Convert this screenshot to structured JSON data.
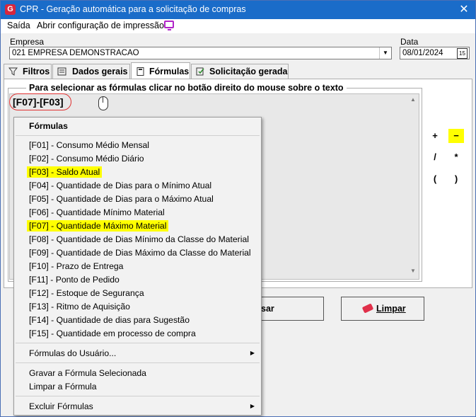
{
  "window": {
    "title": "CPR - Geração automática para a solicitação de compras",
    "close_glyph": "✕",
    "icon": "cpr-app-icon"
  },
  "menubar": {
    "items": [
      "Saída",
      "Abrir configuração de impressão"
    ],
    "print_icon": "monitor-print-icon"
  },
  "form": {
    "empresa_label": "Empresa",
    "empresa_value": "021 EMPRESA DEMONSTRACAO",
    "data_label": "Data",
    "data_value": "08/01/2024",
    "calendar_glyph": "15"
  },
  "tabs": [
    {
      "label": "Filtros",
      "icon": "filter-icon",
      "active": false
    },
    {
      "label": "Dados gerais",
      "icon": "data-icon",
      "active": false
    },
    {
      "label": "Fórmulas",
      "icon": "calculator-icon",
      "active": true
    },
    {
      "label": "Solicitação gerada",
      "icon": "document-check-icon",
      "active": false
    }
  ],
  "formulas_tab": {
    "group_title": "Para selecionar as fórmulas clicar no botão direito do mouse sobre o texto",
    "formula_text": "[F07]-[F03]",
    "operators": [
      "+",
      "−",
      "/",
      "*",
      "(",
      ")"
    ],
    "highlighted_operator": "−"
  },
  "buttons": {
    "process_label_partial": "sar",
    "limpar_label": "Limpar"
  },
  "context_menu": {
    "header": "Fórmulas",
    "items": [
      "[F01] - Consumo Médio Mensal",
      "[F02] - Consumo Médio Diário",
      "[F03] - Saldo Atual",
      "[F04] - Quantidade de Dias para o Mínimo Atual",
      "[F05] - Quantidade de Dias para o Máximo Atual",
      "[F06] - Quantidade Mínimo Material",
      "[F07] - Quantidade Máximo Material",
      "[F08] - Quantidade de Dias Mínimo da Classe do Material",
      "[F09] - Quantidade de Dias Máximo da Classe do Material",
      "[F10] - Prazo de Entrega",
      "[F11] - Ponto de Pedido",
      "[F12] - Estoque de Segurança",
      "[F13] - Ritmo de Aquisição",
      "[F14] - Quantidade de dias para Sugestão",
      "[F15] - Quantidade em processo de compra"
    ],
    "highlighted_items": [
      "[F03] - Saldo Atual",
      "[F07] - Quantidade Máximo Material"
    ],
    "user_formulas": "Fórmulas do Usuário...",
    "save_formula": "Gravar a Fórmula Selecionada",
    "clear_formula": "Limpar a Fórmula",
    "delete_formulas": "Excluir Fórmulas"
  },
  "colors": {
    "titlebar": "#1a6cc9",
    "highlight": "#ffff00",
    "annotation_circle": "#e03030"
  }
}
